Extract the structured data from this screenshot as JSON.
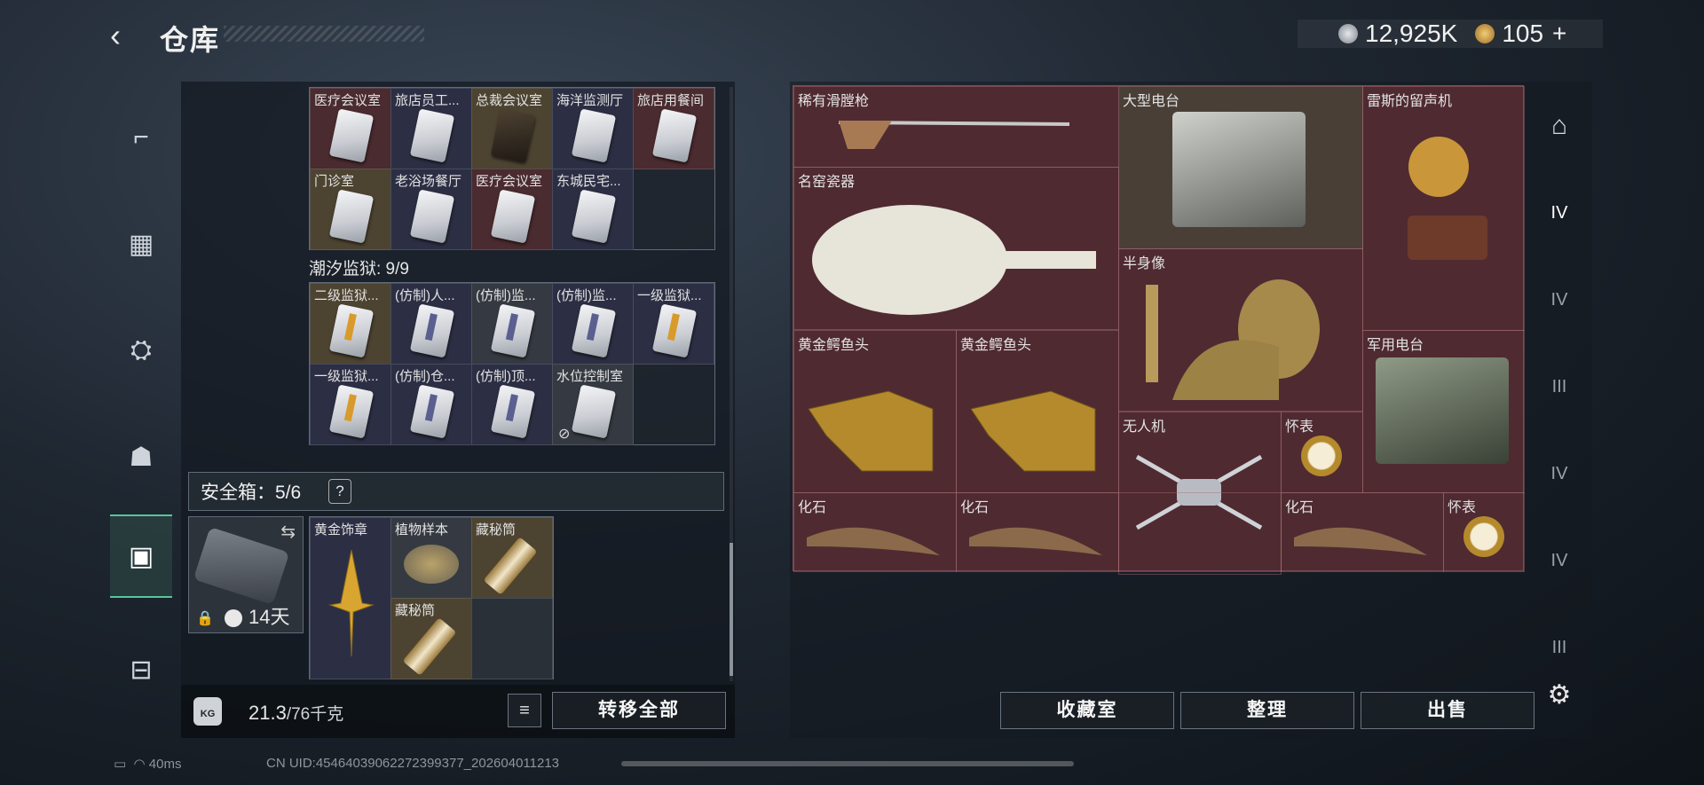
{
  "header": {
    "back_icon": "‹",
    "title": "仓库"
  },
  "currency": {
    "silver_value": "12,925K",
    "gold_value": "105",
    "gold_plus": "+",
    "silver_color": "#c9ccd1",
    "gold_color": "#d7a64a"
  },
  "left_nav": [
    "gun-icon",
    "armor-icon",
    "backpack-icon",
    "chest-rig-icon",
    "safebox-icon",
    "briefcase-icon"
  ],
  "keycards_top": {
    "row1": [
      "医疗会议室",
      "旅店员工...",
      "总裁会议室",
      "海洋监测厅",
      "旅店用餐间"
    ],
    "row2": [
      "门诊室",
      "老浴场餐厅",
      "医疗会议室",
      "东城民宅..."
    ]
  },
  "prison_section": {
    "label": "潮汐监狱: 9/9"
  },
  "keycards_prison": {
    "row1": [
      "二级监狱...",
      "(仿制)人...",
      "(仿制)监...",
      "(仿制)监...",
      "一级监狱..."
    ],
    "row2": [
      "一级监狱...",
      "(仿制)仓...",
      "(仿制)顶...",
      "水位控制室"
    ]
  },
  "safe": {
    "label": "安全箱：5/6",
    "help": "?",
    "days": "14天",
    "items": [
      "黄金饰章",
      "植物样本",
      "藏秘筒",
      "藏秘筒"
    ]
  },
  "bottom_left": {
    "weight_icon": "KG",
    "weight": "21.3",
    "capacity": "/76千克",
    "list_icon": "≡",
    "transfer_all": "转移全部"
  },
  "stash_items": [
    {
      "label": "稀有滑膛枪"
    },
    {
      "label": "大型电台"
    },
    {
      "label": "雷斯的留声机"
    },
    {
      "label": "名窑瓷器"
    },
    {
      "label": "半身像"
    },
    {
      "label": "黄金鳄鱼头"
    },
    {
      "label": "黄金鳄鱼头"
    },
    {
      "label": "军用电台"
    },
    {
      "label": "无人机"
    },
    {
      "label": "怀表"
    },
    {
      "label": "化石"
    },
    {
      "label": "化石"
    },
    {
      "label": "化石"
    },
    {
      "label": "怀表"
    }
  ],
  "bottom_right": {
    "collection": "收藏室",
    "organize": "整理",
    "sell": "出售"
  },
  "right_nav": [
    "IV",
    "IV",
    "III",
    "IV",
    "IV",
    "III"
  ],
  "status": {
    "ping": "40ms",
    "uid": "CN UID:45464039062272399377_202604011213"
  }
}
